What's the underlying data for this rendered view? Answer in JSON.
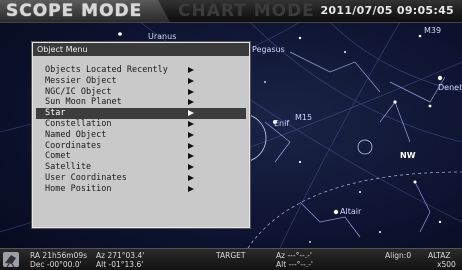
{
  "header": {
    "scope_mode": "SCOPE MODE",
    "chart_mode": "CHART MODE",
    "datetime": "2011/07/05 09:05:45"
  },
  "sky_labels": {
    "uranus": "Uranus",
    "pegasus": "Pegasus",
    "m39": "M39",
    "deneb": "Deneb",
    "enif": "Enif",
    "nw": "NW",
    "altair": "Altair",
    "m15": "M15"
  },
  "menu": {
    "title": "Object Menu",
    "selected_index": 4,
    "items": [
      {
        "label": "Objects Located Recently"
      },
      {
        "label": "Messier Object"
      },
      {
        "label": "NGC/IC Object"
      },
      {
        "label": "Sun Moon Planet"
      },
      {
        "label": "Star"
      },
      {
        "label": "Constellation"
      },
      {
        "label": "Named Object"
      },
      {
        "label": "Coordinates"
      },
      {
        "label": "Comet"
      },
      {
        "label": "Satellite"
      },
      {
        "label": "User Coordinates"
      },
      {
        "label": "Home Position"
      }
    ]
  },
  "status": {
    "ra": "RA 21h56m09s",
    "az": "Az 271°03.4'",
    "dec": "Dec -00°00.0'",
    "alt": "Alt -01°13.6'",
    "target_label": "TARGET",
    "target_az": "Az ---°--.-'",
    "target_alt": "Alt ---°--.-'",
    "align": "Align:0",
    "mount": "ALTAZ",
    "zoom": "x500"
  }
}
